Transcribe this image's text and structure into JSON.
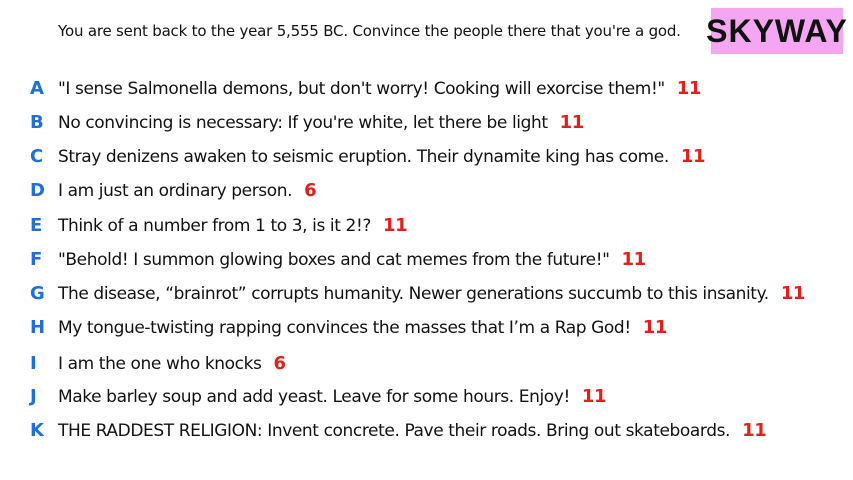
{
  "prompt": "You are sent back to the year 5,555 BC. Convince the people there that you're a god.",
  "logo": "SKYWAY",
  "colors": {
    "letter": "#1f6fd6",
    "score": "#e0201c",
    "logo_bg": "#f4a6f2"
  },
  "answers": [
    {
      "letter": "A",
      "text": "\"I sense Salmonella demons, but don't worry! Cooking will exorcise them!\"",
      "score": "11"
    },
    {
      "letter": "B",
      "text": "No convincing is necessary: If you're white, let there be light",
      "score": "11"
    },
    {
      "letter": "C",
      "text": "Stray denizens awaken to seismic eruption. Their dynamite king has come.",
      "score": "11"
    },
    {
      "letter": "D",
      "text": "I am just an ordinary person.",
      "score": "6"
    },
    {
      "letter": "E",
      "text": "Think of a number from 1 to 3, is it 2!?",
      "score": "11"
    },
    {
      "letter": "F",
      "text": "\"Behold! I summon glowing boxes and cat memes from the future!\"",
      "score": "11"
    },
    {
      "letter": "G",
      "text": "The disease, “brainrot” corrupts humanity. Newer generations succumb to this insanity.",
      "score": "11"
    },
    {
      "letter": "H",
      "text": "My tongue-twisting rapping convinces the masses that I’m a Rap God!",
      "score": "11"
    },
    {
      "letter": "I",
      "text": "I am the one who knocks",
      "score": "6"
    },
    {
      "letter": "J",
      "text": "Make barley soup and add yeast. Leave for some hours. Enjoy!",
      "score": "11"
    },
    {
      "letter": "K",
      "text": "THE RADDEST RELIGION: Invent concrete. Pave their roads. Bring out skateboards.",
      "score": "11"
    }
  ]
}
